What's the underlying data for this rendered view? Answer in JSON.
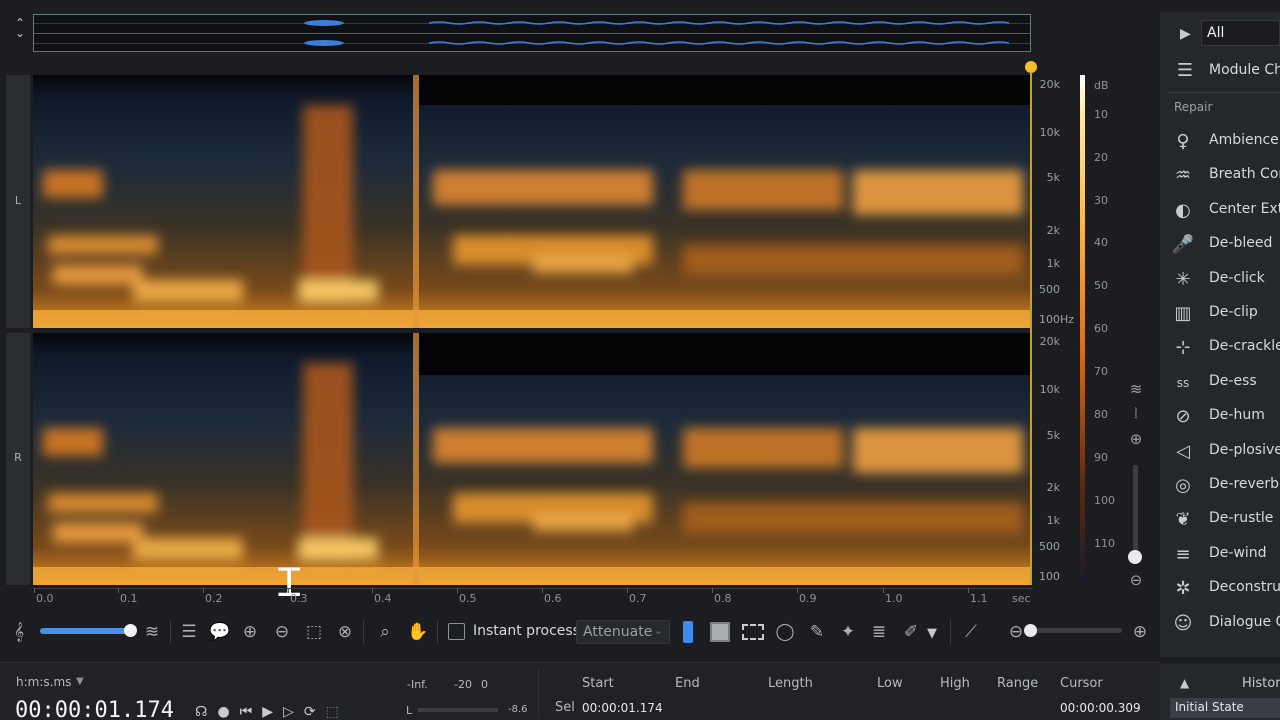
{
  "channels": {
    "left": "L",
    "right": "R"
  },
  "freq_axis": {
    "left_ticks": [
      "20k",
      "10k",
      "5k",
      "2k",
      "1k",
      "500",
      "100"
    ],
    "unit": "Hz",
    "right_ticks": [
      "20k",
      "10k",
      "5k",
      "2k",
      "1k",
      "500",
      "100"
    ]
  },
  "db_scale": {
    "unit": "dB",
    "ticks": [
      "10",
      "20",
      "30",
      "40",
      "50",
      "60",
      "70",
      "80",
      "90",
      "100",
      "110"
    ]
  },
  "time_axis": {
    "ticks": [
      "0.0",
      "0.1",
      "0.2",
      "0.3",
      "0.4",
      "0.5",
      "0.6",
      "0.7",
      "0.8",
      "0.9",
      "1.0",
      "1.1"
    ],
    "unit": "sec"
  },
  "toolbar": {
    "instant_process_label": "Instant process",
    "mode_select_value": "Attenuate"
  },
  "status": {
    "time_format": "h:m:s.ms",
    "time_display": "00:00:01.174",
    "meter_labels": [
      "-Inf.",
      "-20",
      "0"
    ],
    "meter_channel": "L",
    "meter_value": "-8.6",
    "headers": {
      "start": "Start",
      "end": "End",
      "length": "Length",
      "low": "Low",
      "high": "High",
      "range": "Range",
      "cursor": "Cursor"
    },
    "sel_label": "Sel",
    "sel_start": "00:00:01.174",
    "cursor_value": "00:00:00.309"
  },
  "right_panel": {
    "play_all_label": "All",
    "module_chain_label": "Module Ch",
    "section_label": "Repair",
    "modules": [
      {
        "label": "Ambience",
        "icon": "ambience-icon"
      },
      {
        "label": "Breath Con",
        "icon": "breath-icon"
      },
      {
        "label": "Center Extr",
        "icon": "center-extract-icon"
      },
      {
        "label": "De-bleed",
        "icon": "microphone-icon"
      },
      {
        "label": "De-click",
        "icon": "click-icon"
      },
      {
        "label": "De-clip",
        "icon": "clip-icon"
      },
      {
        "label": "De-crackle",
        "icon": "crackle-icon"
      },
      {
        "label": "De-ess",
        "icon": "ess-icon"
      },
      {
        "label": "De-hum",
        "icon": "hum-icon"
      },
      {
        "label": "De-plosive",
        "icon": "plosive-icon"
      },
      {
        "label": "De-reverb",
        "icon": "reverb-icon"
      },
      {
        "label": "De-rustle",
        "icon": "rustle-icon"
      },
      {
        "label": "De-wind",
        "icon": "wind-icon"
      },
      {
        "label": "Deconstru",
        "icon": "deconstruct-icon"
      },
      {
        "label": "Dialogue C",
        "icon": "dialogue-icon"
      }
    ],
    "history_label": "Histor",
    "history_item": "Initial State"
  }
}
